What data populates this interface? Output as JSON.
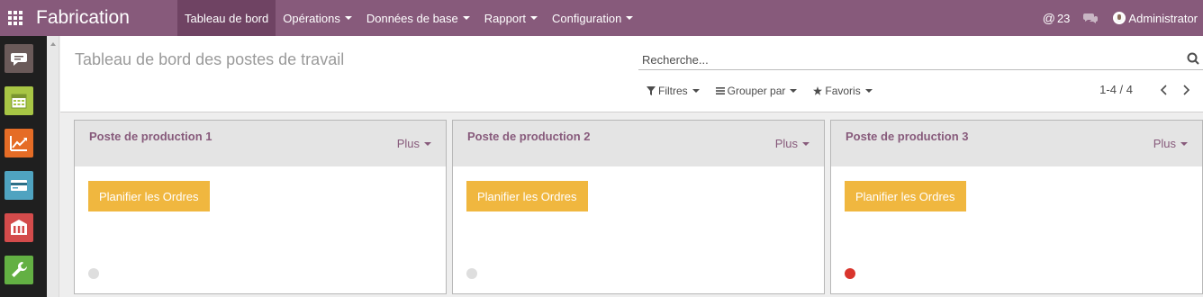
{
  "navbar": {
    "brand": "Fabrication",
    "menu": [
      {
        "label": "Tableau de bord",
        "active": true
      },
      {
        "label": "Opérations"
      },
      {
        "label": "Données de base"
      },
      {
        "label": "Rapport"
      },
      {
        "label": "Configuration"
      }
    ],
    "mentions_count": "23",
    "user": "Administrator",
    "color": "#875a7b"
  },
  "sidebar": {
    "apps": [
      {
        "icon": "discuss-icon",
        "color": "#6a5a59"
      },
      {
        "icon": "calendar-icon",
        "color": "#a8c645"
      },
      {
        "icon": "sales-chart-icon",
        "color": "#e56c26"
      },
      {
        "icon": "invoicing-icon",
        "color": "#4fa3c0"
      },
      {
        "icon": "warehouse-icon",
        "color": "#d34b4b"
      },
      {
        "icon": "manufacturing-icon",
        "color": "#63b043"
      }
    ]
  },
  "control_panel": {
    "title": "Tableau de bord des postes de travail",
    "search_placeholder": "Recherche...",
    "filters": "Filtres",
    "group_by": "Grouper par",
    "favorites": "Favoris",
    "pager": "1-4 / 4"
  },
  "workcenters": [
    {
      "name": "Poste de production 1",
      "more": "Plus",
      "action": "Planifier les Ordres",
      "status_color": "#dedede"
    },
    {
      "name": "Poste de production 2",
      "more": "Plus",
      "action": "Planifier les Ordres",
      "status_color": "#dedede"
    },
    {
      "name": "Poste de production 3",
      "more": "Plus",
      "action": "Planifier les Ordres",
      "status_color": "#d9352d"
    }
  ],
  "colors": {
    "accent": "#875a7b",
    "button": "#f0b73f",
    "status_blocked": "#d9352d",
    "status_normal": "#dedede"
  }
}
